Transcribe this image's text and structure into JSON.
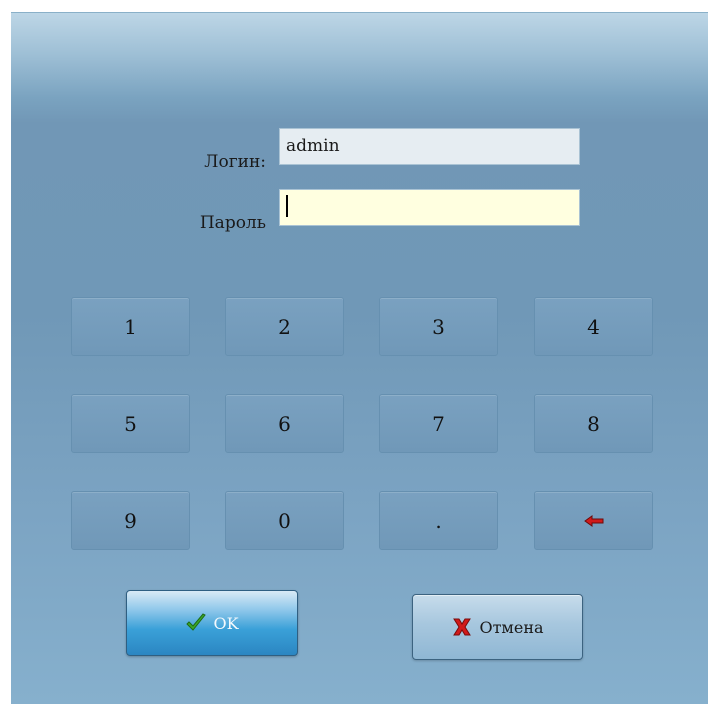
{
  "form": {
    "login_label": "Логин:",
    "login_value": "admin",
    "password_label": "Пароль",
    "password_value": ""
  },
  "keypad": {
    "keys": [
      "1",
      "2",
      "3",
      "4",
      "5",
      "6",
      "7",
      "8",
      "9",
      "0",
      "."
    ],
    "backspace_icon": "backspace-arrow-icon"
  },
  "buttons": {
    "ok_label": "OK",
    "ok_icon": "checkmark-icon",
    "cancel_label": "Отмена",
    "cancel_icon": "red-x-icon"
  },
  "colors": {
    "ok_accent": "#2b86c2",
    "cancel_icon": "#d11a1a",
    "check_icon": "#3aa82a",
    "password_field_bg": "#ffffe0"
  }
}
